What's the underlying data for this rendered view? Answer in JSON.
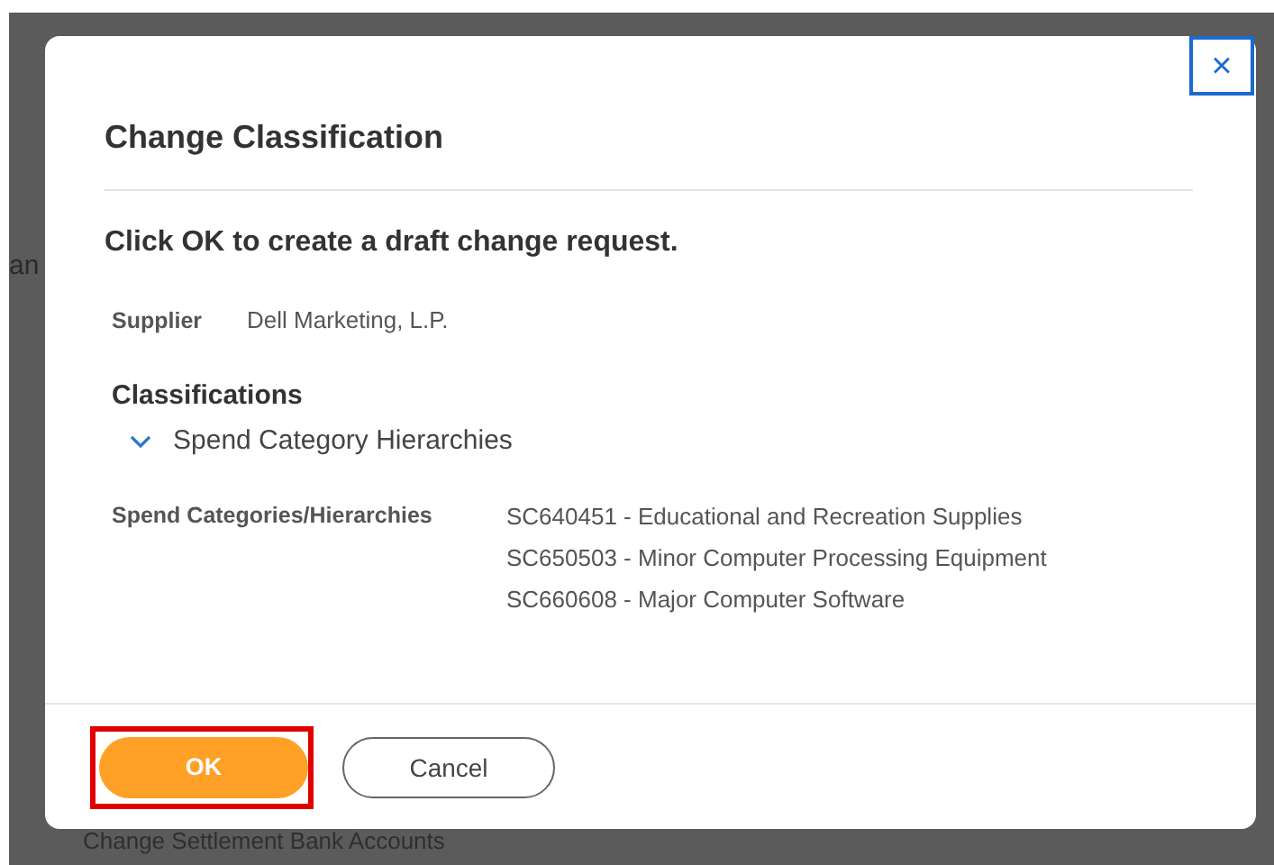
{
  "background": {
    "left_fragment": "an",
    "link": "Change Settlement Bank Accounts"
  },
  "dialog": {
    "title": "Change Classification",
    "close": "×",
    "instruction": "Click OK to create a draft change request.",
    "supplier": {
      "label": "Supplier",
      "value": "Dell Marketing, L.P."
    },
    "section": {
      "title": "Classifications",
      "group": {
        "label": "Spend Category Hierarchies",
        "expanded": true
      }
    },
    "categories": {
      "label": "Spend Categories/Hierarchies",
      "values": [
        "SC640451 - Educational and Recreation Supplies",
        "SC650503 - Minor Computer Processing Equipment",
        "SC660608 - Major Computer Software"
      ]
    },
    "buttons": [
      {
        "label": "OK",
        "kind": "primary",
        "highlighted": true
      },
      {
        "label": "Cancel",
        "kind": "secondary",
        "highlighted": false
      }
    ]
  }
}
